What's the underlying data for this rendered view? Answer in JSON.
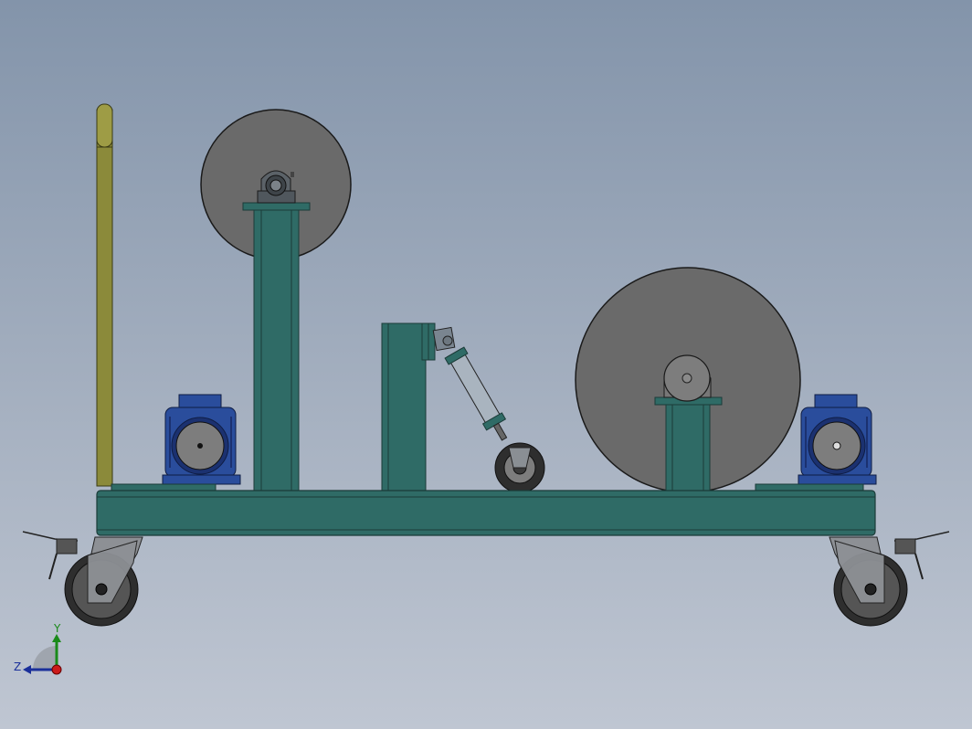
{
  "triad": {
    "y_label": "Y",
    "z_label": "Z"
  },
  "colors": {
    "frame": "#2f6b66",
    "frame_edge": "#1b3b38",
    "disk": "#6a6a6a",
    "disk_edge": "#1a1a1a",
    "motor_blue": "#2a4d9c",
    "motor_dark": "#1b3170",
    "handle": "#8b8a3a",
    "cylinder": "#a9b4bf",
    "wheel_tire": "#2e2e2e",
    "caster_bracket": "#8d9095"
  }
}
